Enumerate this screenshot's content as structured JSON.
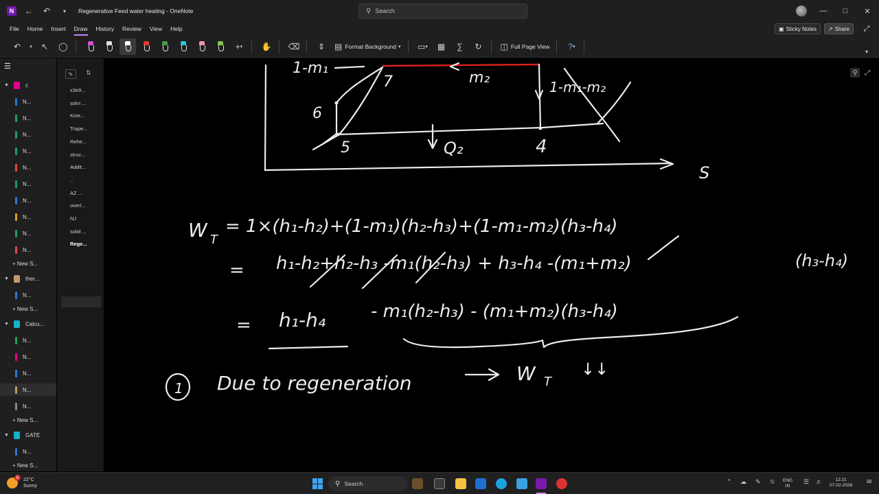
{
  "window": {
    "title": "Regenerative Feed water heating",
    "app_name": "OneNote",
    "title_separator": "-"
  },
  "search": {
    "placeholder": "Search"
  },
  "menu": {
    "items": [
      "File",
      "Home",
      "Insert",
      "Draw",
      "History",
      "Review",
      "View",
      "Help"
    ],
    "active": "Draw",
    "sticky_notes": "Sticky Notes",
    "share": "Share"
  },
  "ribbon": {
    "pen_colors": [
      "#d34fd3",
      "#e0e0e0",
      "#ffffff",
      "#e53935",
      "#43a047",
      "#26c6da",
      "#f48fb1",
      "#8bc34a"
    ],
    "format_background": "Format Background",
    "full_page_view": "Full Page View"
  },
  "notebooks": [
    {
      "label": "c",
      "color": "#e3008c",
      "sections": [
        {
          "label": "N...",
          "color": "#2b79d9"
        },
        {
          "label": "N...",
          "color": "#1aa260"
        },
        {
          "label": "N...",
          "color": "#1aa260"
        },
        {
          "label": "N...",
          "color": "#1aa260"
        },
        {
          "label": "N...",
          "color": "#e04848"
        },
        {
          "label": "N...",
          "color": "#1aa260"
        },
        {
          "label": "N...",
          "color": "#2b79d9"
        },
        {
          "label": "N...",
          "color": "#e0a020"
        },
        {
          "label": "N...",
          "color": "#1aa260"
        },
        {
          "label": "N...",
          "color": "#e04848"
        }
      ],
      "new_section": "New S..."
    },
    {
      "label": "ther...",
      "color": "#c19a6b",
      "sections": [
        {
          "label": "N...",
          "color": "#2b79d9"
        }
      ],
      "new_section": "New S..."
    },
    {
      "label": "Calcu...",
      "color": "#17b3c9",
      "sections": [
        {
          "label": "N...",
          "color": "#1aa260"
        },
        {
          "label": "N...",
          "color": "#e3008c"
        },
        {
          "label": "N...",
          "color": "#2b79d9"
        },
        {
          "label": "N...",
          "color": "#c19a6b"
        },
        {
          "label": "N...",
          "color": "#888888"
        }
      ],
      "new_section": "New S..."
    },
    {
      "label": "GATE",
      "color": "#17b3c9",
      "sections": [
        {
          "label": "N...",
          "color": "#2b79d9"
        }
      ],
      "new_section": "New S..."
    }
  ],
  "pages": [
    "x3e9...",
    "solvi ...",
    "Kine...",
    "Trape...",
    "Rehe...",
    "struc...",
    "Addit...",
    "..",
    "AZ ...",
    "overl...",
    "NJ",
    "solid ...",
    "Rege..."
  ],
  "selected_page": "Rege...",
  "ink": {
    "diagram_labels": [
      "1-m₁",
      "7",
      "m₂",
      "1-m₁-m₂",
      "6",
      "5",
      "Q₂",
      "4",
      "S"
    ],
    "eq1_lhs": "W",
    "eq1_lhs_sub": "T",
    "eq1_rhs": "= 1×(h₁-h₂)+(1-m₁)(h₂-h₃)+(1-m₁-m₂)(h₃-h₄)",
    "eq2_eq": "=",
    "eq2_rhs": "h₁-h₂+h₂-h₃ -m₁(h₂-h₃) + h₃-h₄ -(m₁+m₂)",
    "eq2_tail": "(h₃-h₄)",
    "eq3_eq": "=",
    "eq3_part1": "h₁-h₄",
    "eq3_part2": "- m₁(h₂-h₃) - (m₁+m₂)(h₃-h₄)",
    "note_index": "1",
    "note_text": "Due to regeneration",
    "note_result": "W",
    "note_result_sub": "T",
    "note_arrows": "↓↓"
  },
  "taskbar": {
    "weather_temp": "22°C",
    "weather_desc": "Sunny",
    "weather_badge": "6",
    "search": "Search",
    "lang_top": "ENG",
    "lang_bottom": "IN",
    "time": "12:21",
    "date": "07-02-2026"
  }
}
